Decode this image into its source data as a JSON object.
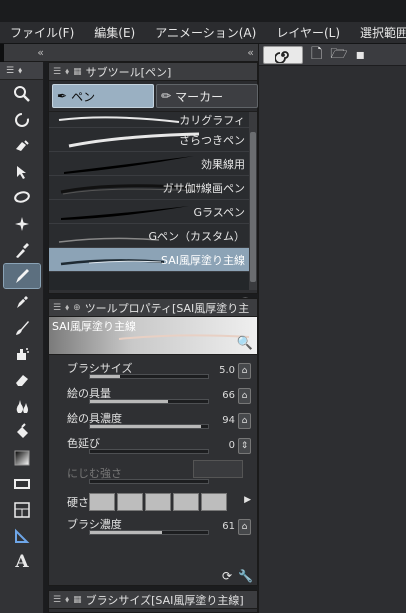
{
  "menubar": {
    "items": [
      "ファイル(F)",
      "編集(E)",
      "アニメーション(A)",
      "レイヤー(L)",
      "選択範囲(S)"
    ]
  },
  "subtool_panel": {
    "title": "サブツール[ペン]",
    "tabs": [
      {
        "label": "ペン",
        "active": true
      },
      {
        "label": "マーカー",
        "active": false
      }
    ],
    "brushes": [
      {
        "name": "カリグラフィ",
        "active": false
      },
      {
        "name": "ざらつきペン",
        "active": false
      },
      {
        "name": "効果線用",
        "active": false
      },
      {
        "name": "ガサ伽ｻ線画ペン",
        "active": false
      },
      {
        "name": "Gラスペン",
        "active": false
      },
      {
        "name": "Gペン（カスタム）",
        "active": false
      },
      {
        "name": "SAI風厚塗り主線",
        "active": true
      }
    ]
  },
  "tool_property": {
    "title": "ツールプロパティ[SAI風厚塗り主",
    "preview_name": "SAI風厚塗り主線",
    "rows": [
      {
        "label": "ブラシサイズ",
        "value": "5.0",
        "fill": 0.25
      },
      {
        "label": "絵の具量",
        "value": "66",
        "fill": 0.66
      },
      {
        "label": "絵の具濃度",
        "value": "94",
        "fill": 0.94
      },
      {
        "label": "色延び",
        "value": "0",
        "fill": 0
      },
      {
        "label": "にじむ強さ",
        "value": "",
        "fill": 0
      },
      {
        "label": "硬さ",
        "value": "",
        "fill": 1
      },
      {
        "label": "ブラシ濃度",
        "value": "61",
        "fill": 0.61
      }
    ]
  },
  "brushsize_panel": {
    "title": "ブラシサイズ[SAI風厚塗り主線]"
  },
  "toolbar": {
    "tools": [
      "zoom-icon",
      "rotate-icon",
      "move-icon",
      "transform-icon",
      "lasso-icon",
      "magic-wand-icon",
      "eyedropper-icon",
      "pen-icon",
      "pencil-icon",
      "brush-icon",
      "airbrush-icon",
      "eraser-icon",
      "blend-icon",
      "fill-icon",
      "gradient-icon",
      "rectangle-icon",
      "frame-icon",
      "ruler-icon",
      "text-icon"
    ]
  },
  "colors": {
    "accent": "#8ca3b6",
    "active_tab": "#9ab0c2",
    "bg": "#2f3033"
  }
}
